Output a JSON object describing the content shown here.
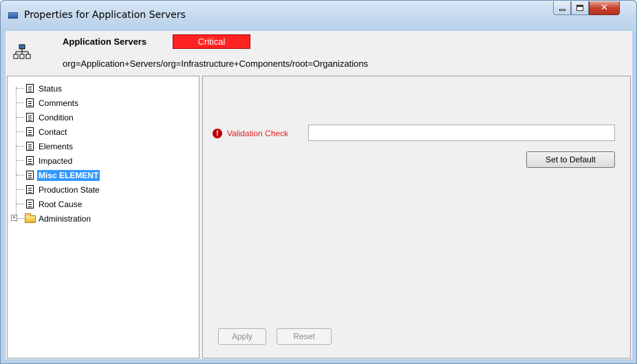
{
  "window": {
    "title": "Properties for Application Servers",
    "controls": {
      "minimize": "minimize-icon",
      "maximize": "maximize-icon",
      "close": "close-icon"
    }
  },
  "header": {
    "icon": "hierarchy-icon",
    "name": "Application Servers",
    "severity": "Critical",
    "severity_color": "#ff2222",
    "dn": "org=Application+Servers/org=Infrastructure+Components/root=Organizations"
  },
  "tree": {
    "items": [
      {
        "label": "Status",
        "selected": false
      },
      {
        "label": "Comments",
        "selected": false
      },
      {
        "label": "Condition",
        "selected": false
      },
      {
        "label": "Contact",
        "selected": false
      },
      {
        "label": "Elements",
        "selected": false
      },
      {
        "label": "Impacted",
        "selected": false
      },
      {
        "label": "Misc ELEMENT",
        "selected": true
      },
      {
        "label": "Production State",
        "selected": false
      },
      {
        "label": "Root Cause",
        "selected": false
      }
    ],
    "folder": {
      "label": "Administration",
      "expander": "+"
    }
  },
  "detail": {
    "validation_label": "Validation Check",
    "validation_value": "",
    "error_glyph": "!",
    "set_default_label": "Set to Default",
    "apply_label": "Apply",
    "reset_label": "Reset"
  }
}
